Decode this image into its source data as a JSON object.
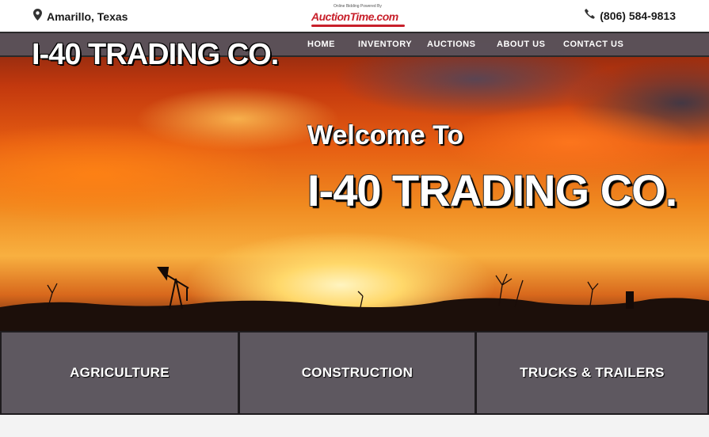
{
  "topbar": {
    "location": "Amarillo, Texas",
    "location_icon": "map-pin-icon",
    "phone": "(806) 584-9813",
    "phone_icon": "phone-icon",
    "partner_logo": {
      "tagline": "Online Bidding Powered By",
      "name": "AuctionTime.com"
    }
  },
  "nav": {
    "items": [
      {
        "label": "HOME"
      },
      {
        "label": "INVENTORY"
      },
      {
        "label": "AUCTIONS"
      },
      {
        "label": "ABOUT US"
      },
      {
        "label": "CONTACT US"
      }
    ]
  },
  "hero": {
    "logo_text": "I-40 TRADING CO.",
    "welcome": "Welcome To",
    "title": "I-40 TRADING CO."
  },
  "categories": [
    {
      "label": "AGRICULTURE"
    },
    {
      "label": "CONSTRUCTION"
    },
    {
      "label": "TRUCKS & TRAILERS"
    }
  ],
  "colors": {
    "nav_bg": "#58525c",
    "tile_bg": "#5e5860",
    "brand_red": "#c8202b",
    "text_dark": "#1a1a1a"
  }
}
